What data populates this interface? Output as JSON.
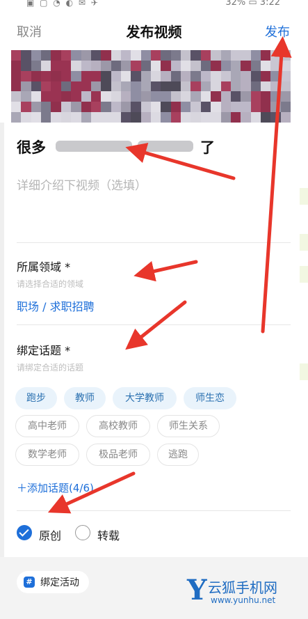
{
  "status_bar": {
    "left_icons": "▣ ▢ ◔ ◐ ✉ ✈",
    "right_text": "32% ▭ 3:22"
  },
  "nav": {
    "cancel": "取消",
    "title": "发布视频",
    "publish": "发布"
  },
  "video": {
    "title_start": "很多",
    "title_end": "了",
    "description_placeholder": "详细介绍下视频（选填）"
  },
  "domain_section": {
    "label": "所属领域 *",
    "hint": "请选择合适的领域",
    "value": "职场 / 求职招聘"
  },
  "topic_section": {
    "label": "绑定话题 *",
    "hint": "请绑定合适的话题",
    "selected_topics": [
      "跑步",
      "教师",
      "大学教师",
      "师生恋"
    ],
    "suggested_topics_row1": [
      "高中老师",
      "高校教师",
      "师生关系"
    ],
    "suggested_topics_row2": [
      "数学老师",
      "极品老师",
      "逃跑"
    ],
    "add_topic": "＋添加话题(4/6)"
  },
  "source": {
    "original": "原创",
    "repost": "转载",
    "selected": "原创"
  },
  "bottom": {
    "bind_activity": "绑定活动",
    "hash_glyph": "#"
  },
  "watermark": {
    "logo_glyph": "Y",
    "name": "云狐手机网",
    "url": "www.yunhu.net"
  },
  "colors": {
    "accent": "#1e6fd9",
    "chip_selected_bg": "#e9f3fb",
    "annotation_arrow": "#e8362b"
  }
}
